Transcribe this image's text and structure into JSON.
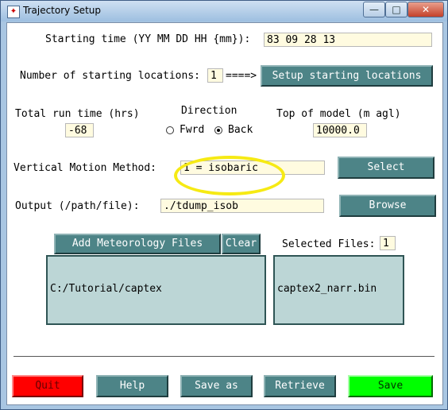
{
  "window": {
    "title": "Trajectory Setup",
    "controls": {
      "minimize": "—",
      "maximize": "□",
      "close": "✕"
    }
  },
  "starting_time": {
    "label": "Starting time (YY MM DD HH {mm}):",
    "value": "83 09 28 13"
  },
  "starting_locations": {
    "label": "Number of starting locations:",
    "value": "1",
    "arrow": "====>",
    "button": "Setup starting locations"
  },
  "run_time": {
    "label": "Total run time (hrs)",
    "value": "-68"
  },
  "direction": {
    "label": "Direction",
    "fwrd": "Fwrd",
    "back": "Back",
    "selected": "back"
  },
  "top_of_model": {
    "label": "Top of model (m agl)",
    "value": "10000.0"
  },
  "vertical_motion": {
    "label": "Vertical Motion Method:",
    "value": "1 = isobaric",
    "button": "Select"
  },
  "output": {
    "label": "Output (/path/file):",
    "value": "./tdump_isob",
    "button": "Browse"
  },
  "meteorology": {
    "add_button": "Add Meteorology Files",
    "clear_button": "Clear",
    "directory": "C:/Tutorial/captex",
    "selected_label": "Selected Files:",
    "selected_count": "1",
    "selected_files": [
      "captex2_narr.bin"
    ]
  },
  "footer": {
    "quit": "Quit",
    "help": "Help",
    "save_as": "Save as",
    "retrieve": "Retrieve",
    "save": "Save"
  },
  "colors": {
    "button": "#4d8487",
    "quit": "#ff0000",
    "save": "#00ff00",
    "field": "#fffbe0",
    "listbox": "#bcd6d6",
    "highlight": "#f6ea14"
  }
}
